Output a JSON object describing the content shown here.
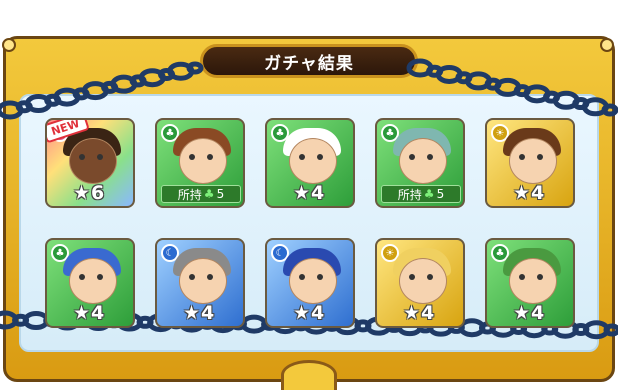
{
  "title": "ガチャ結果",
  "colors": {
    "frame": "#f3c93c",
    "title_bg": "#2c170a",
    "chain": "#2a4a7a"
  },
  "new_badge": "NEW",
  "owned_prefix": "所持",
  "cards": [
    {
      "element": "rainbow",
      "stars": "6",
      "new": true,
      "owned": null,
      "skin": "dark",
      "hair": "#3a2414"
    },
    {
      "element": "green",
      "stars": "",
      "new": false,
      "owned": "5",
      "skin": "light",
      "hair": "#8a4a24"
    },
    {
      "element": "green",
      "stars": "4",
      "new": false,
      "owned": null,
      "skin": "light",
      "hair": "#ffffff"
    },
    {
      "element": "green",
      "stars": "",
      "new": false,
      "owned": "5",
      "skin": "light",
      "hair": "#7fb7b0"
    },
    {
      "element": "yellow",
      "stars": "4",
      "new": false,
      "owned": null,
      "skin": "light",
      "hair": "#6a3a1a"
    },
    {
      "element": "green",
      "stars": "4",
      "new": false,
      "owned": null,
      "skin": "light",
      "hair": "#3a6ad0"
    },
    {
      "element": "blue",
      "stars": "4",
      "new": false,
      "owned": null,
      "skin": "light",
      "hair": "#8a8a8a"
    },
    {
      "element": "blue",
      "stars": "4",
      "new": false,
      "owned": null,
      "skin": "light",
      "hair": "#2a4ab0"
    },
    {
      "element": "yellow",
      "stars": "4",
      "new": false,
      "owned": null,
      "skin": "light",
      "hair": "#f0d060"
    },
    {
      "element": "green",
      "stars": "4",
      "new": false,
      "owned": null,
      "skin": "light",
      "hair": "#4a9a40"
    }
  ]
}
